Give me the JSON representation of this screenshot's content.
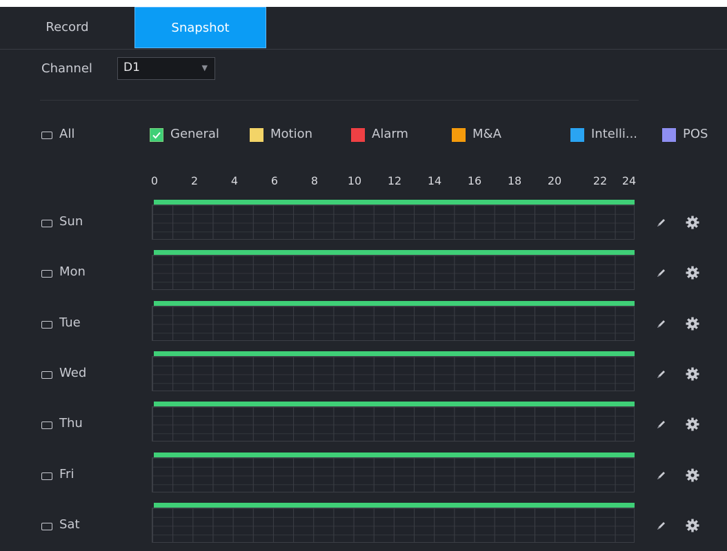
{
  "tabs": [
    "Record",
    "Snapshot"
  ],
  "active_tab": "Snapshot",
  "channel": {
    "label": "Channel",
    "value": "D1",
    "arrow": "▼"
  },
  "all_label": "All",
  "legend": [
    {
      "label": "General",
      "color": "#3fcf77",
      "checked": true
    },
    {
      "label": "Motion",
      "color": "#f3d467",
      "checked": false
    },
    {
      "label": "Alarm",
      "color": "#ef4044",
      "checked": false
    },
    {
      "label": "M&A",
      "color": "#f59b0c",
      "checked": false
    },
    {
      "label": "Intelli...",
      "color": "#2aa4f2",
      "checked": false
    },
    {
      "label": "POS",
      "color": "#8e8ef1",
      "checked": false
    }
  ],
  "hours": [
    "0",
    "2",
    "4",
    "6",
    "8",
    "10",
    "12",
    "14",
    "16",
    "18",
    "20",
    "22",
    "24"
  ],
  "days": [
    {
      "label": "Sun",
      "schedule": [
        [
          0,
          24
        ]
      ]
    },
    {
      "label": "Mon",
      "schedule": [
        [
          0,
          24
        ]
      ]
    },
    {
      "label": "Tue",
      "schedule": [
        [
          0,
          24
        ]
      ]
    },
    {
      "label": "Wed",
      "schedule": [
        [
          0,
          24
        ]
      ]
    },
    {
      "label": "Thu",
      "schedule": [
        [
          0,
          24
        ]
      ]
    },
    {
      "label": "Fri",
      "schedule": [
        [
          0,
          24
        ]
      ]
    },
    {
      "label": "Sat",
      "schedule": [
        [
          0,
          24
        ]
      ]
    }
  ],
  "schedule_color": "#3fcf77",
  "row_icons": [
    "pencil-icon",
    "gear-icon"
  ]
}
